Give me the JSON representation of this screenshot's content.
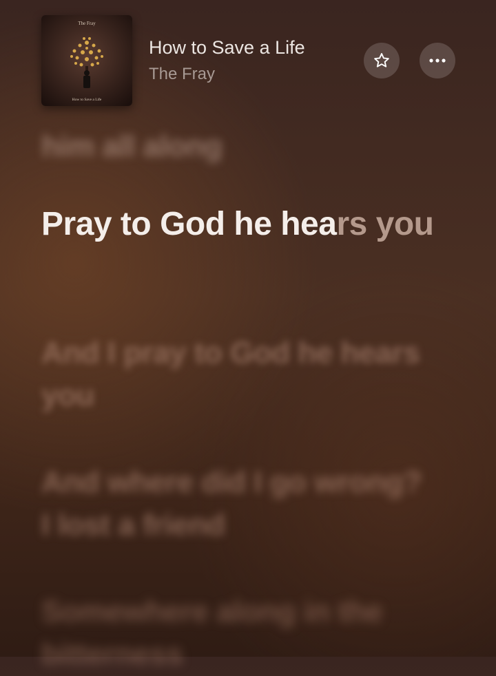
{
  "now_playing": {
    "title": "How to Save a Life",
    "artist": "The Fray",
    "artwork": {
      "top_text": "The Fray",
      "bottom_text": "How to Save a Life",
      "icon": "album-artwork-tree"
    }
  },
  "buttons": {
    "favorite_icon": "star-outline-icon",
    "more_icon": "ellipsis-icon"
  },
  "lyrics": {
    "previous_line": "him all along",
    "current_line": {
      "sung": "Pray to God he hea",
      "unsung": "rs you"
    },
    "upcoming_lines": [
      "And I pray to God he hears you",
      "And where did I go wrong? I lost a friend",
      "Somewhere along in the bitterness"
    ]
  },
  "colors": {
    "background": "#3e2519",
    "active_lyric": "#f4eeea",
    "pending_lyric": "#b4998c"
  }
}
